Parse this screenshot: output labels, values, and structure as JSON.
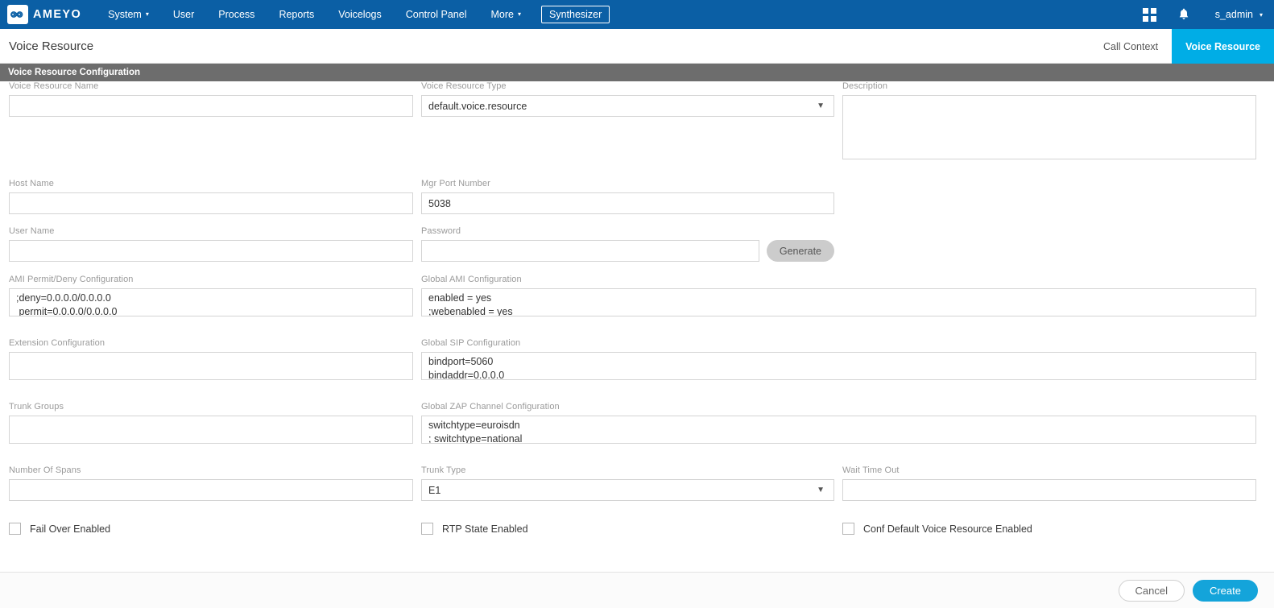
{
  "navbar": {
    "brand": "AMEYO",
    "brand_icon": "infinity-logo-icon",
    "items": [
      {
        "label": "System",
        "caret": "▾"
      },
      {
        "label": "User",
        "caret": ""
      },
      {
        "label": "Process",
        "caret": ""
      },
      {
        "label": "Reports",
        "caret": ""
      },
      {
        "label": "Voicelogs",
        "caret": ""
      },
      {
        "label": "Control Panel",
        "caret": ""
      },
      {
        "label": "More",
        "caret": "▾"
      }
    ],
    "synthesizer_label": "Synthesizer",
    "apps_icon": "grid-apps-icon",
    "notifications_icon": "bell-icon",
    "user": "s_admin",
    "user_caret": "▾",
    "bg_color": "#0b5fa5"
  },
  "pagehead": {
    "title": "Voice Resource",
    "tabs": [
      {
        "label": "Call Context",
        "active": false
      },
      {
        "label": "Voice Resource",
        "active": true
      }
    ],
    "active_color": "#00ade6"
  },
  "section": {
    "title": "Voice Resource Configuration",
    "bg_color": "#6d6d6d"
  },
  "form": {
    "voice_resource_name": {
      "label": "Voice Resource Name",
      "value": "",
      "placeholder": ""
    },
    "voice_resource_type": {
      "label": "Voice Resource Type",
      "value": "default.voice.resource",
      "options": [
        "default.voice.resource"
      ],
      "arrow": "▼"
    },
    "description": {
      "label": "Description",
      "value": "",
      "placeholder": ""
    },
    "host_name": {
      "label": "Host Name",
      "value": "",
      "placeholder": ""
    },
    "mgr_port_number": {
      "label": "Mgr Port Number",
      "value": "5038",
      "placeholder": ""
    },
    "user_name": {
      "label": "User Name",
      "value": "",
      "placeholder": ""
    },
    "password": {
      "label": "Password",
      "value": "",
      "placeholder": ""
    },
    "generate_button": "Generate",
    "ami_permit_deny": {
      "label": "AMI Permit/Deny Configuration",
      "value": ";deny=0.0.0.0/0.0.0.0\n permit=0.0.0.0/0.0.0.0"
    },
    "global_ami": {
      "label": "Global AMI Configuration",
      "value": "enabled = yes\n;webenabled = yes"
    },
    "extension_configuration": {
      "label": "Extension Configuration",
      "value": ""
    },
    "global_sip": {
      "label": "Global SIP Configuration",
      "value": "bindport=5060\nbindaddr=0.0.0.0"
    },
    "trunk_groups": {
      "label": "Trunk Groups",
      "value": ""
    },
    "global_zap": {
      "label": "Global ZAP Channel Configuration",
      "value": "switchtype=euroisdn\n; switchtype=national"
    },
    "number_of_spans": {
      "label": "Number Of Spans",
      "value": "",
      "placeholder": ""
    },
    "trunk_type": {
      "label": "Trunk Type",
      "value": "E1",
      "options": [
        "E1"
      ],
      "arrow": "▼"
    },
    "wait_time_out": {
      "label": "Wait Time Out",
      "value": "",
      "placeholder": ""
    },
    "checkboxes": [
      {
        "label": "Fail Over Enabled",
        "checked": false
      },
      {
        "label": "RTP State Enabled",
        "checked": false
      },
      {
        "label": "Conf Default Voice Resource Enabled",
        "checked": false
      }
    ]
  },
  "footer": {
    "cancel_label": "Cancel",
    "create_label": "Create",
    "create_color": "#14a4da"
  }
}
